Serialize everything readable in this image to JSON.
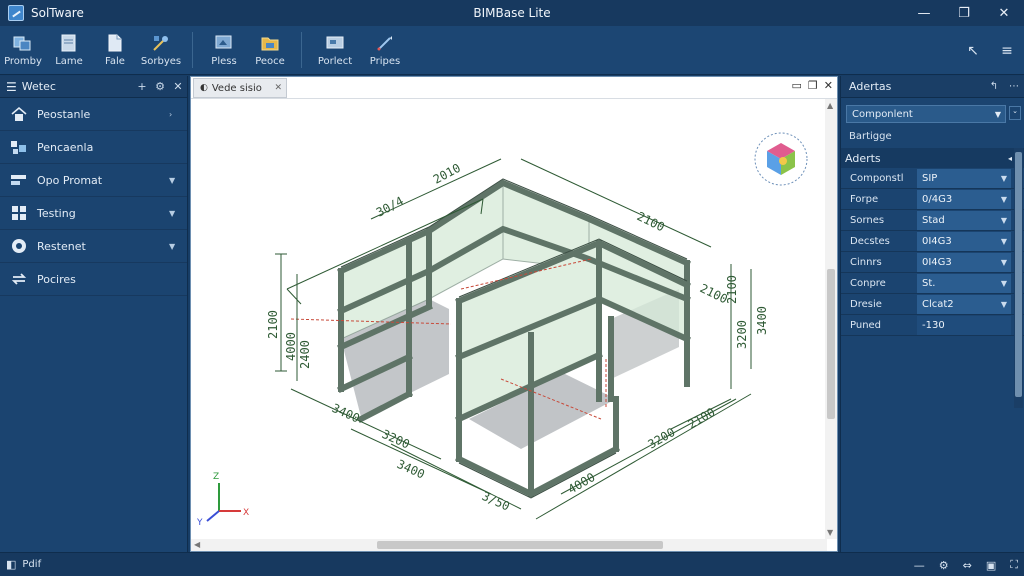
{
  "titlebar": {
    "app_name": "SolTware",
    "window_title": "BIMBase Lite",
    "minimize_glyph": "—",
    "restore_glyph": "❐",
    "close_glyph": "✕"
  },
  "ribbon": {
    "buttons": [
      {
        "label": "Promby",
        "icon": "structure-icon"
      },
      {
        "label": "Lame",
        "icon": "document-icon"
      },
      {
        "label": "Fale",
        "icon": "file-icon"
      },
      {
        "label": "Sorbyes",
        "icon": "settings-wand-icon"
      },
      {
        "label": "Pless",
        "icon": "view-icon"
      },
      {
        "label": "Peoce",
        "icon": "folder-icon"
      },
      {
        "label": "Porlect",
        "icon": "projection-icon"
      },
      {
        "label": "Pripes",
        "icon": "pen-icon"
      }
    ],
    "right_back_glyph": "↖",
    "right_menu_glyph": "≡"
  },
  "left_panel": {
    "title": "Wetec",
    "add_glyph": "+",
    "items": [
      {
        "label": "Peostanle",
        "icon": "home-icon",
        "caret": "›"
      },
      {
        "label": "Pencaenla",
        "icon": "cubes-icon",
        "caret": ""
      },
      {
        "label": "Opo Promat",
        "icon": "layers-icon",
        "caret": "▼"
      },
      {
        "label": "Testing",
        "icon": "grid-icon",
        "caret": "▼"
      },
      {
        "label": "Restenet",
        "icon": "globe-icon",
        "caret": "▼"
      },
      {
        "label": "Pocires",
        "icon": "sync-icon",
        "caret": ""
      }
    ]
  },
  "viewport": {
    "tab_label": "Vede sisio",
    "tab_close": "✕",
    "controls": [
      "▭",
      "❐",
      "✕"
    ],
    "axis_labels": {
      "z": "Z",
      "x": "X",
      "y": "Y"
    },
    "dim_labels": [
      "30/4",
      "2010",
      "2100",
      "2100",
      "4000",
      "2400",
      "3200",
      "3400",
      "3400",
      "3200",
      "3400",
      "3/50",
      "4000",
      "3200",
      "2100",
      "2100",
      "2100"
    ]
  },
  "right_panel": {
    "title": "Adertas",
    "select_value": "Componlent",
    "sub_label": "Bartigge",
    "section_title": "Aderts",
    "properties": [
      {
        "name": "Componstl",
        "value": "SIP",
        "dropdown": true
      },
      {
        "name": "Forpe",
        "value": "0/4G3",
        "dropdown": true
      },
      {
        "name": "Sornes",
        "value": "Stad",
        "dropdown": true
      },
      {
        "name": "Decstes",
        "value": "0I4G3",
        "dropdown": true
      },
      {
        "name": "Cinnrs",
        "value": "0I4G3",
        "dropdown": true
      },
      {
        "name": "Conpre",
        "value": "St.",
        "dropdown": true
      },
      {
        "name": "Dresie",
        "value": "Clcat2",
        "dropdown": true
      },
      {
        "name": "Puned",
        "value": "-130",
        "dropdown": false
      }
    ]
  },
  "statusbar": {
    "label": "Pdif"
  },
  "colors": {
    "frame": "#5f7467",
    "glass": "#cfe6d2",
    "dimension": "#2e5a34",
    "background": "#173d66"
  }
}
